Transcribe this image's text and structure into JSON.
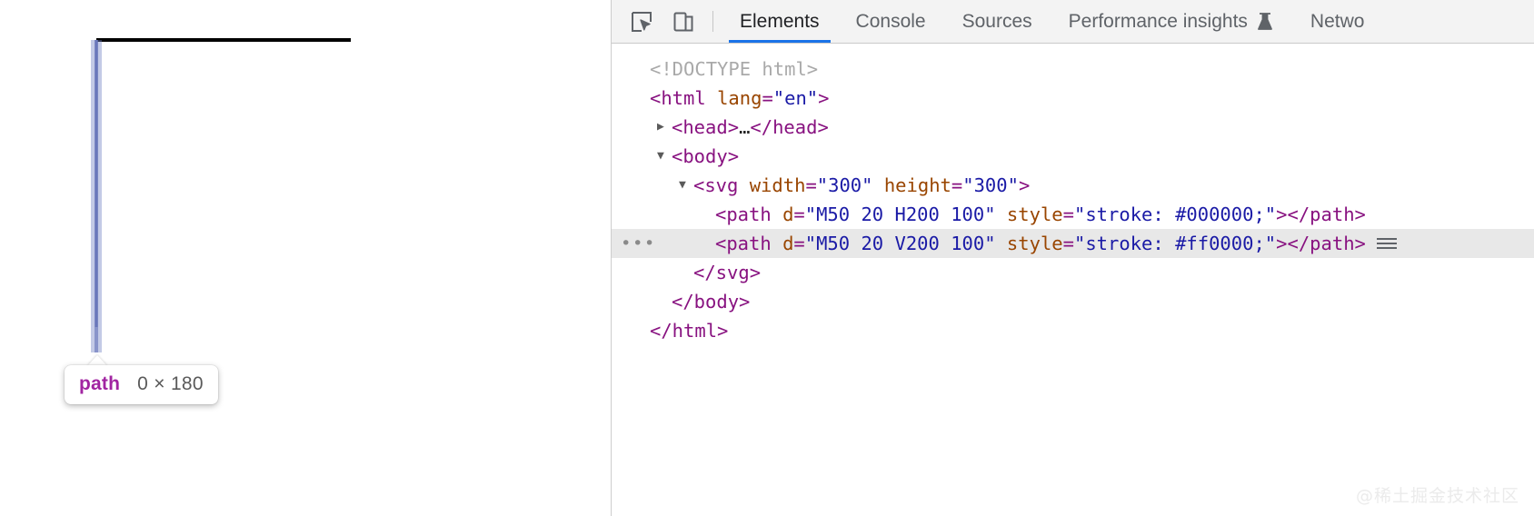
{
  "viewport": {
    "selected_element_badge": {
      "tag": "path",
      "dimensions": "0 × 180"
    },
    "highlight_color": "#6f80c4"
  },
  "devtools": {
    "toolbar": {
      "inspect_button": "inspect-element-icon",
      "device_toolbar_button": "device-toolbar-icon",
      "tabs": [
        {
          "label": "Elements",
          "active": true,
          "icon": ""
        },
        {
          "label": "Console",
          "active": false,
          "icon": ""
        },
        {
          "label": "Sources",
          "active": false,
          "icon": ""
        },
        {
          "label": "Performance insights",
          "active": false,
          "icon": "flask-icon"
        },
        {
          "label": "Netwo",
          "active": false,
          "icon": ""
        }
      ],
      "accent_color": "#1a73e8"
    },
    "dom_tree": [
      {
        "indent": 0,
        "twisty": "",
        "gutter": "",
        "selected": false,
        "tokens": [
          {
            "t": "doctype",
            "v": "<!DOCTYPE html>"
          }
        ]
      },
      {
        "indent": 0,
        "twisty": "",
        "gutter": "",
        "selected": false,
        "tokens": [
          {
            "t": "tag",
            "v": "<html "
          },
          {
            "t": "attr",
            "v": "lang"
          },
          {
            "t": "punct",
            "v": "="
          },
          {
            "t": "val",
            "v": "\"en\""
          },
          {
            "t": "tag",
            "v": ">"
          }
        ]
      },
      {
        "indent": 1,
        "twisty": "▶",
        "gutter": "",
        "selected": false,
        "tokens": [
          {
            "t": "tag",
            "v": "<head>"
          },
          {
            "t": "text",
            "v": "…"
          },
          {
            "t": "tag",
            "v": "</head>"
          }
        ]
      },
      {
        "indent": 1,
        "twisty": "▼",
        "gutter": "",
        "selected": false,
        "tokens": [
          {
            "t": "tag",
            "v": "<body>"
          }
        ]
      },
      {
        "indent": 2,
        "twisty": "▼",
        "gutter": "",
        "selected": false,
        "tokens": [
          {
            "t": "tag",
            "v": "<svg "
          },
          {
            "t": "attr",
            "v": "width"
          },
          {
            "t": "punct",
            "v": "="
          },
          {
            "t": "val",
            "v": "\"300\""
          },
          {
            "t": "text",
            "v": " "
          },
          {
            "t": "attr",
            "v": "height"
          },
          {
            "t": "punct",
            "v": "="
          },
          {
            "t": "val",
            "v": "\"300\""
          },
          {
            "t": "tag",
            "v": ">"
          }
        ]
      },
      {
        "indent": 3,
        "twisty": "",
        "gutter": "",
        "selected": false,
        "tokens": [
          {
            "t": "tag",
            "v": "<path "
          },
          {
            "t": "attr",
            "v": "d"
          },
          {
            "t": "punct",
            "v": "="
          },
          {
            "t": "val",
            "v": "\"M50 20 H200 100\""
          },
          {
            "t": "text",
            "v": " "
          },
          {
            "t": "attr",
            "v": "style"
          },
          {
            "t": "punct",
            "v": "="
          },
          {
            "t": "val",
            "v": "\"stroke: #000000;\""
          },
          {
            "t": "tag",
            "v": "></path>"
          }
        ]
      },
      {
        "indent": 3,
        "twisty": "",
        "gutter": "•••",
        "selected": true,
        "badge": "grid-badge",
        "tokens": [
          {
            "t": "tag",
            "v": "<path "
          },
          {
            "t": "attr",
            "v": "d"
          },
          {
            "t": "punct",
            "v": "="
          },
          {
            "t": "val",
            "v": "\"M50 20 V200 100\""
          },
          {
            "t": "text",
            "v": " "
          },
          {
            "t": "attr",
            "v": "style"
          },
          {
            "t": "punct",
            "v": "="
          },
          {
            "t": "val",
            "v": "\"stroke: #ff0000;\""
          },
          {
            "t": "tag",
            "v": "></path>"
          }
        ]
      },
      {
        "indent": 2,
        "twisty": "",
        "gutter": "",
        "selected": false,
        "tokens": [
          {
            "t": "tag",
            "v": "</svg>"
          }
        ]
      },
      {
        "indent": 1,
        "twisty": "",
        "gutter": "",
        "selected": false,
        "tokens": [
          {
            "t": "tag",
            "v": "</body>"
          }
        ]
      },
      {
        "indent": 0,
        "twisty": "",
        "gutter": "",
        "selected": false,
        "tokens": [
          {
            "t": "tag",
            "v": "</html>"
          }
        ]
      }
    ]
  },
  "watermark": "@稀土掘金技术社区"
}
